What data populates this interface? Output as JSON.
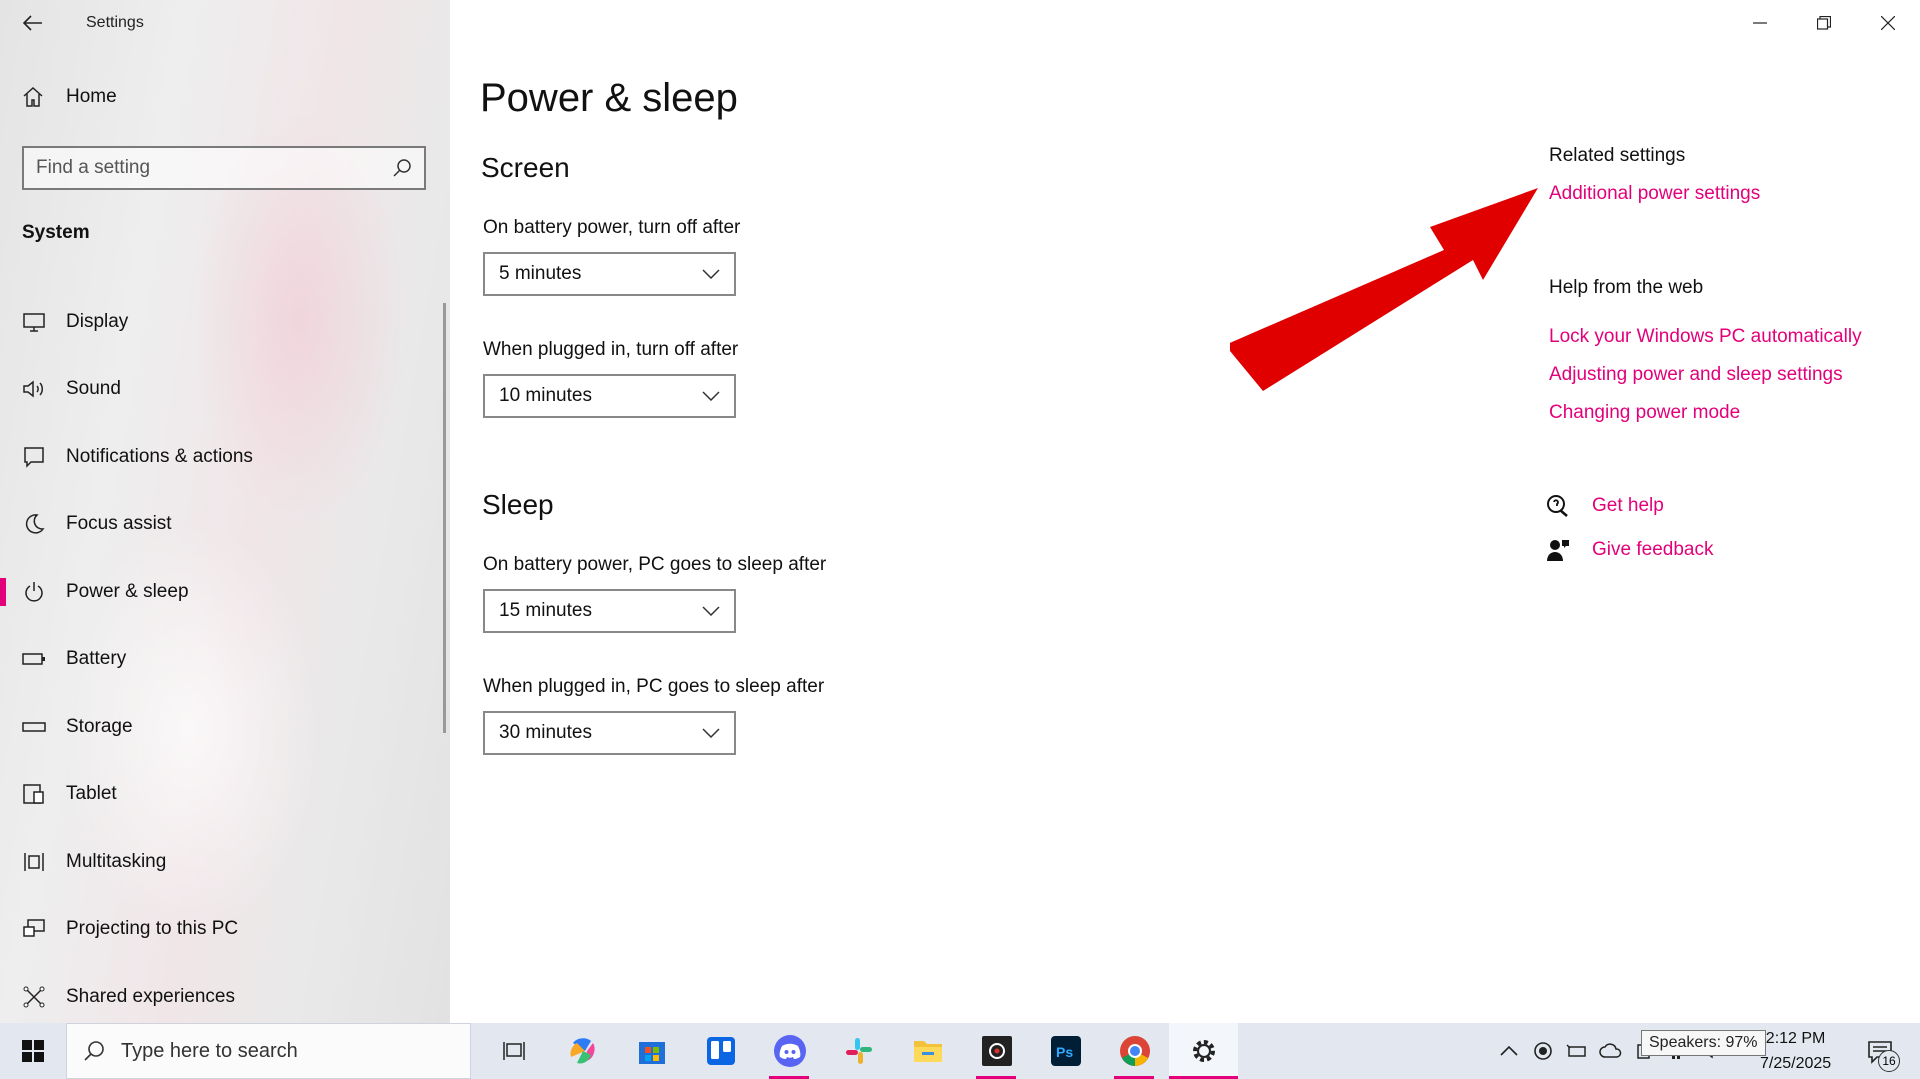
{
  "window": {
    "title": "Settings",
    "controls": [
      "minimize",
      "restore",
      "close"
    ]
  },
  "sidebar": {
    "home_label": "Home",
    "search_placeholder": "Find a setting",
    "section_label": "System",
    "items": [
      {
        "label": "Display",
        "icon": "monitor-icon"
      },
      {
        "label": "Sound",
        "icon": "speaker-icon"
      },
      {
        "label": "Notifications & actions",
        "icon": "notification-icon"
      },
      {
        "label": "Focus assist",
        "icon": "moon-icon"
      },
      {
        "label": "Power & sleep",
        "icon": "power-icon",
        "selected": true
      },
      {
        "label": "Battery",
        "icon": "battery-icon"
      },
      {
        "label": "Storage",
        "icon": "storage-icon"
      },
      {
        "label": "Tablet",
        "icon": "tablet-icon"
      },
      {
        "label": "Multitasking",
        "icon": "multitasking-icon"
      },
      {
        "label": "Projecting to this PC",
        "icon": "projecting-icon"
      },
      {
        "label": "Shared experiences",
        "icon": "shared-icon"
      }
    ]
  },
  "main": {
    "title": "Power & sleep",
    "screen": {
      "heading": "Screen",
      "battery_label": "On battery power, turn off after",
      "battery_value": "5 minutes",
      "plugged_label": "When plugged in, turn off after",
      "plugged_value": "10 minutes"
    },
    "sleep": {
      "heading": "Sleep",
      "battery_label": "On battery power, PC goes to sleep after",
      "battery_value": "15 minutes",
      "plugged_label": "When plugged in, PC goes to sleep after",
      "plugged_value": "30 minutes"
    }
  },
  "related": {
    "heading": "Related settings",
    "additional_power": "Additional power settings",
    "help_heading": "Help from the web",
    "help_links": [
      "Lock your Windows PC automatically",
      "Adjusting power and sleep settings",
      "Changing power mode"
    ],
    "get_help": "Get help",
    "give_feedback": "Give feedback"
  },
  "taskbar": {
    "search_placeholder": "Type here to search",
    "tooltip": "Speakers: 97%",
    "time": "2:12 PM",
    "date": "7/25/2025",
    "notification_count": "16"
  },
  "colors": {
    "accent": "#e3007b",
    "annotation_arrow": "#e00000",
    "taskbar_bg": "#e3e8f0"
  }
}
